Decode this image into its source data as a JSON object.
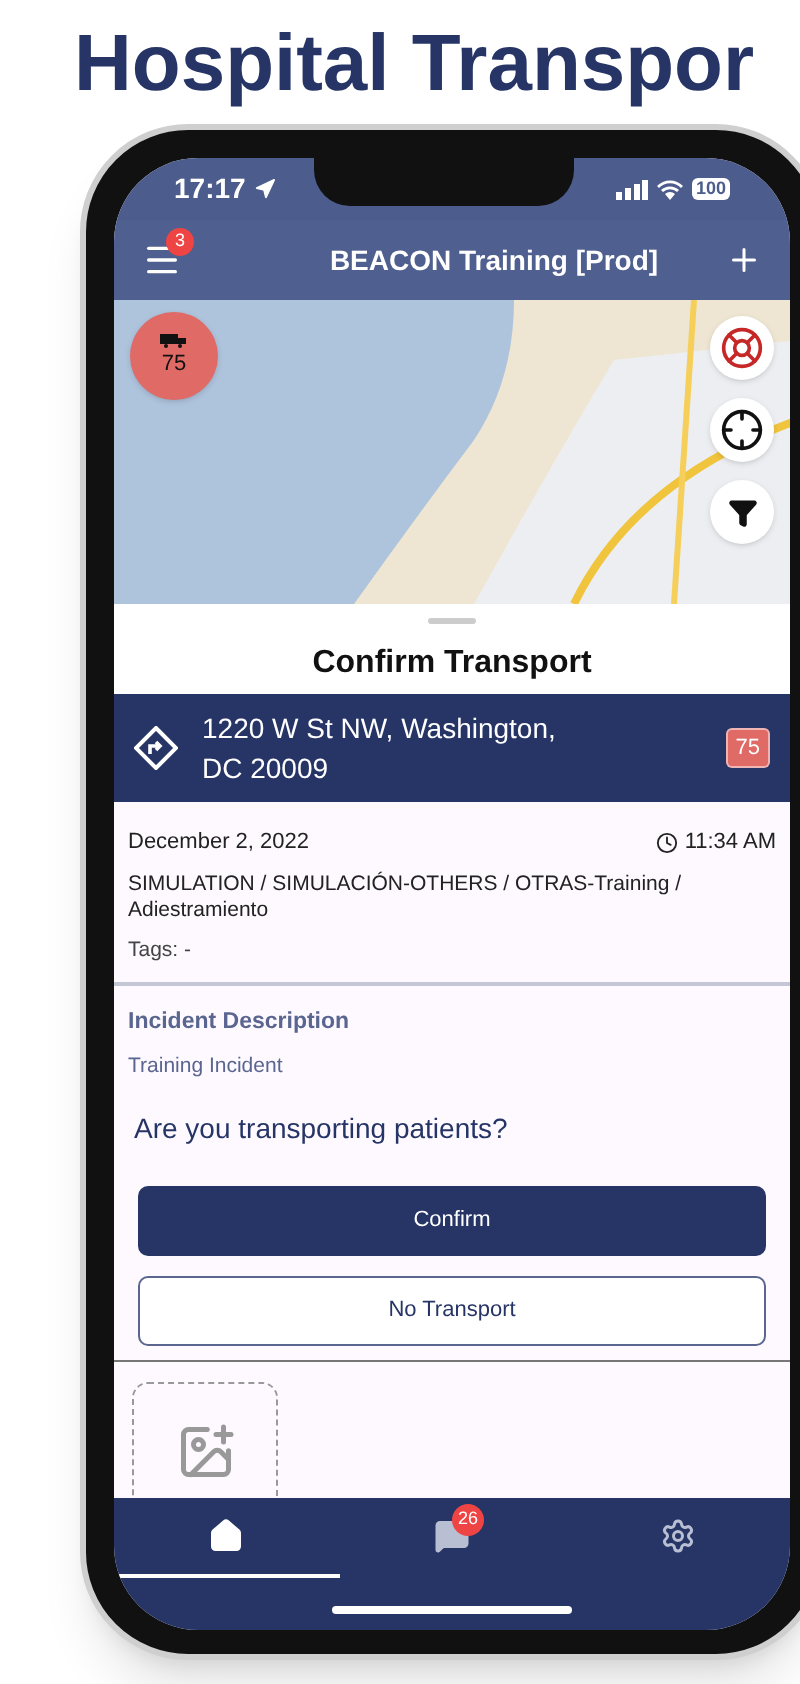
{
  "headline": "Hospital Transpor",
  "status_bar": {
    "time": "17:17",
    "battery": "100"
  },
  "header": {
    "title": "BEACON Training [Prod]",
    "menu_badge": "3"
  },
  "map": {
    "unit_marker": {
      "count": "75"
    }
  },
  "sheet": {
    "title": "Confirm Transport",
    "address": {
      "text": "1220 W St NW, Washington, DC 20009",
      "unit": "75"
    },
    "details": {
      "date": "December 2, 2022",
      "time": "11:34 AM",
      "category": "SIMULATION / SIMULACIÓN-OTHERS / OTRAS-Training / Adiestramiento",
      "tags": "Tags: -"
    },
    "incident": {
      "label": "Incident Description",
      "value": "Training Incident"
    },
    "question": "Are you transporting patients?",
    "buttons": [
      {
        "kind": "primary",
        "label": "Confirm"
      },
      {
        "kind": "outline",
        "label": "No Transport"
      }
    ]
  },
  "nav": [
    {
      "kind": "home",
      "selected": true
    },
    {
      "kind": "messages",
      "badge": "26",
      "selected": false
    },
    {
      "kind": "settings",
      "selected": false
    }
  ]
}
